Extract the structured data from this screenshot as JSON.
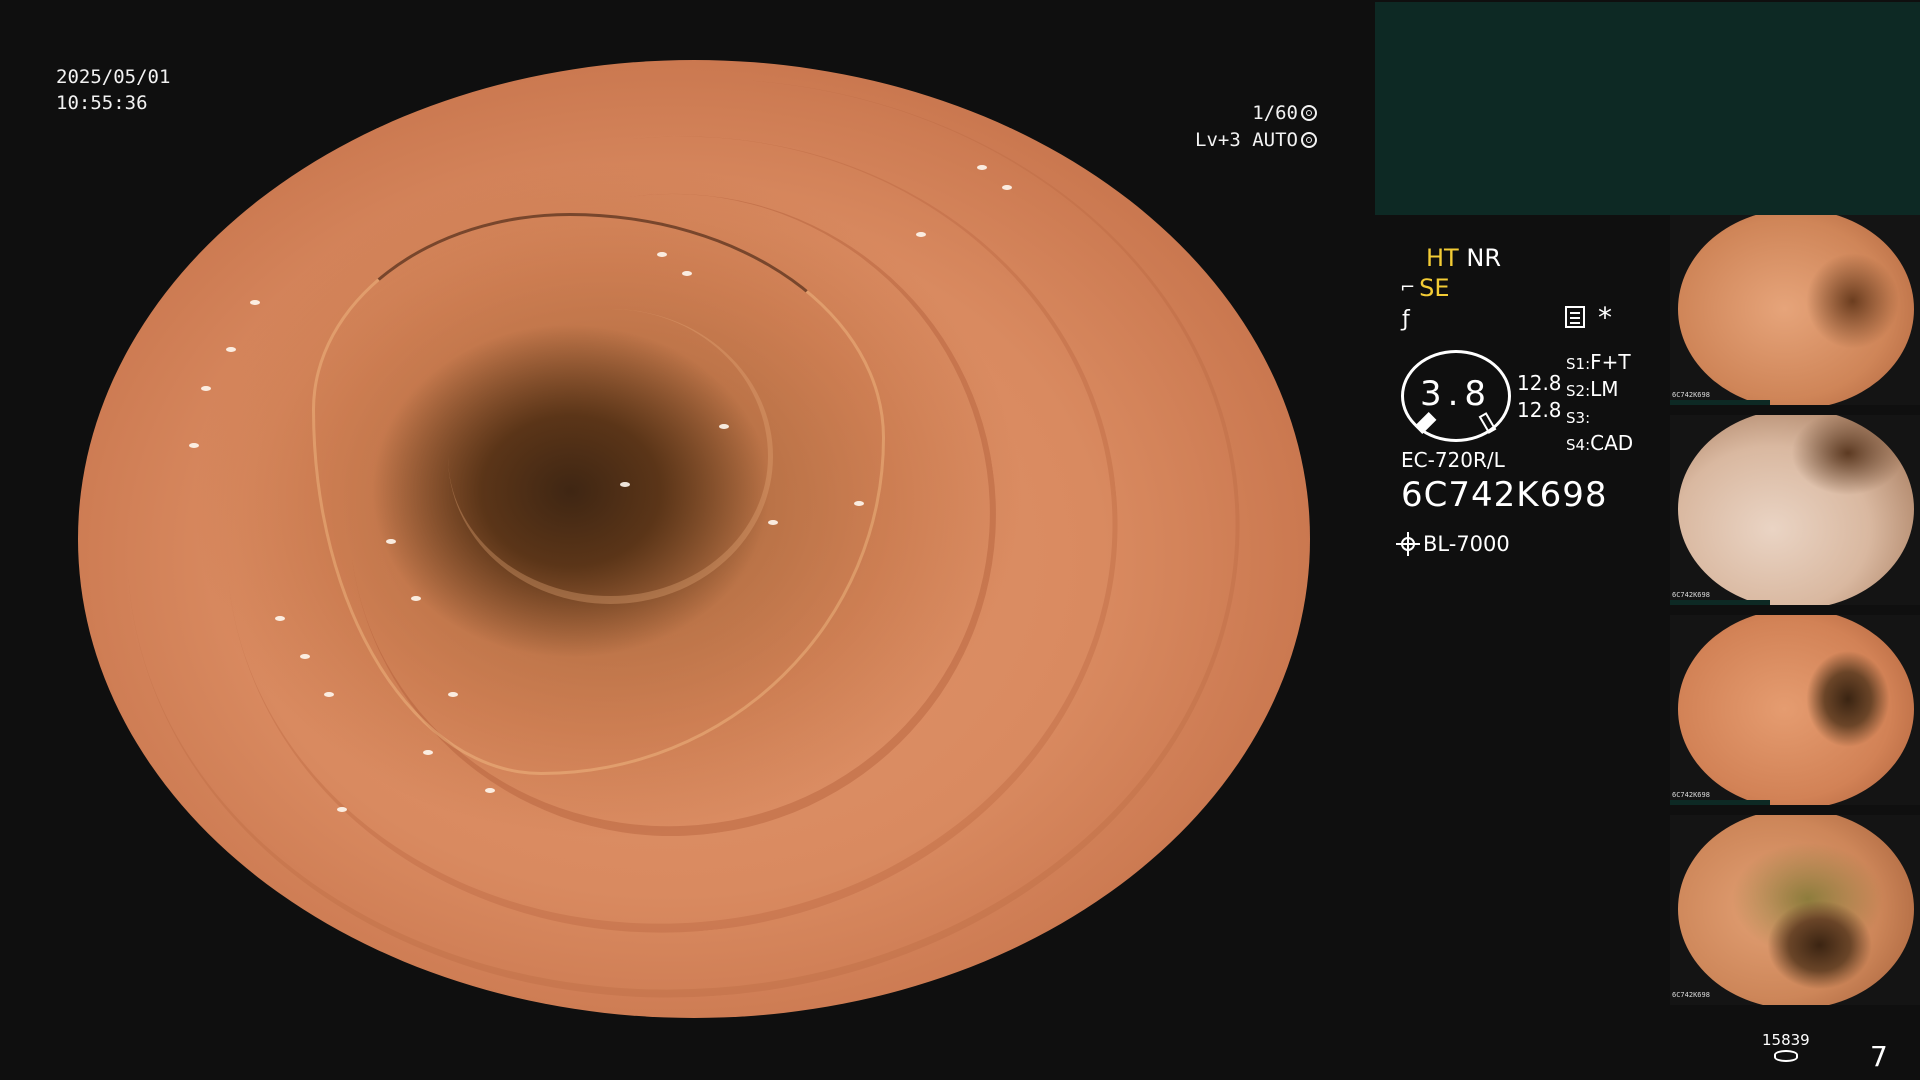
{
  "overlay": {
    "date": "2025/05/01",
    "time": "10:55:36",
    "shutter": "1/60",
    "level": "Lv+3",
    "iris_mode": "AUTO"
  },
  "status": {
    "ht": "HT",
    "nr": "NR",
    "se": "SE"
  },
  "gauge": {
    "value": "3.8"
  },
  "readings": {
    "line1": "12.8",
    "line2": "12.8"
  },
  "slots": [
    {
      "key": "S1",
      "value": "F+T"
    },
    {
      "key": "S2",
      "value": "LM"
    },
    {
      "key": "S3",
      "value": ""
    },
    {
      "key": "S4",
      "value": "CAD"
    }
  ],
  "scope": {
    "model": "EC-720R/L",
    "serial": "6C742K698"
  },
  "light_source": "BL-7000",
  "thumbnails": [
    {
      "label": "6C742K698"
    },
    {
      "label": "6C742K698"
    },
    {
      "label": "6C742K698"
    },
    {
      "label": "6C742K698"
    }
  ],
  "storage": {
    "count": "15839"
  },
  "page": "7",
  "icons": {
    "shutter_icon": "aperture-icon",
    "auto_icon": "iris-icon",
    "scope_icon": "endoscope-icon",
    "freeze_icon": "freeze-icon",
    "note_icon": "memo-icon",
    "star_icon": "asterisk-icon",
    "light_icon": "lamp-icon",
    "storage_icon": "storage-icon"
  },
  "colors": {
    "accent_yellow": "#f3cc35",
    "panel_teal": "#0d2924"
  }
}
